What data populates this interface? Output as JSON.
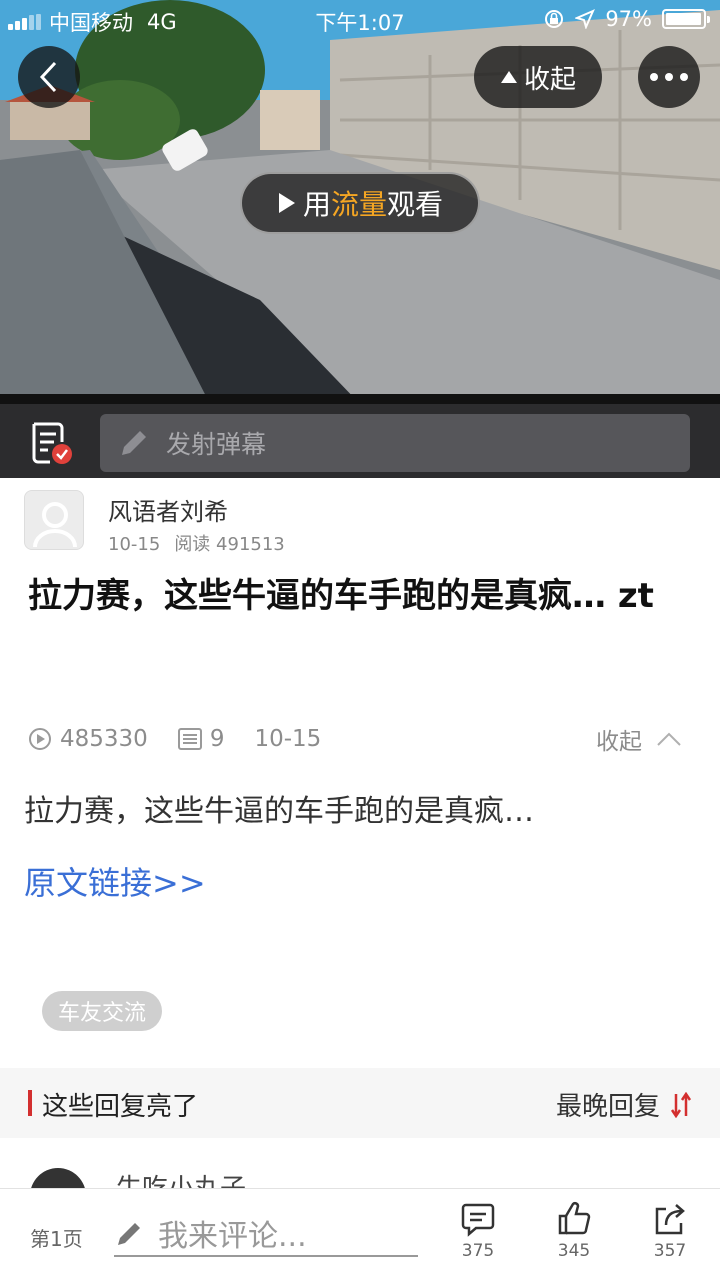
{
  "status_bar": {
    "carrier": "中国移动",
    "network": "4G",
    "time": "下午1:07",
    "battery": "97%",
    "battery_level": 0.97
  },
  "video": {
    "collapse_label": "收起",
    "play_prefix": "用",
    "play_highlight": "流量",
    "play_suffix": "观看"
  },
  "danmaku": {
    "placeholder": "发射弹幕"
  },
  "post": {
    "author": "风语者刘希",
    "date": "10-15",
    "read_label": "阅读 491513",
    "title": "拉力赛，这些牛逼的车手跑的是真疯… zt",
    "play_count": "485330",
    "comment_count": "9",
    "post_date": "10-15",
    "collapse_label": "收起",
    "description": "拉力赛，这些牛逼的车手跑的是真疯…",
    "original_link": "原文链接>>",
    "tag": "车友交流"
  },
  "replies": {
    "section_title": "这些回复亮了",
    "sort_label": "最晚回复",
    "peek_name": "牛吃小丸子"
  },
  "bottom_bar": {
    "page_label": "第1页",
    "comment_placeholder": "我来评论...",
    "comments": "375",
    "likes": "345",
    "shares": "357"
  },
  "colors": {
    "accent_orange": "#f5a623",
    "link_blue": "#3a6fd6",
    "section_red": "#d32f2f",
    "danmaku_bg": "#2c2c2e"
  },
  "icons": [
    "back-icon",
    "triangle-up-icon",
    "more-icon",
    "play-icon",
    "danmaku-list-icon",
    "pencil-icon",
    "play-circle-icon",
    "list-icon",
    "chevron-up-icon",
    "sort-icon",
    "comment-icon",
    "thumbs-up-icon",
    "share-icon"
  ]
}
